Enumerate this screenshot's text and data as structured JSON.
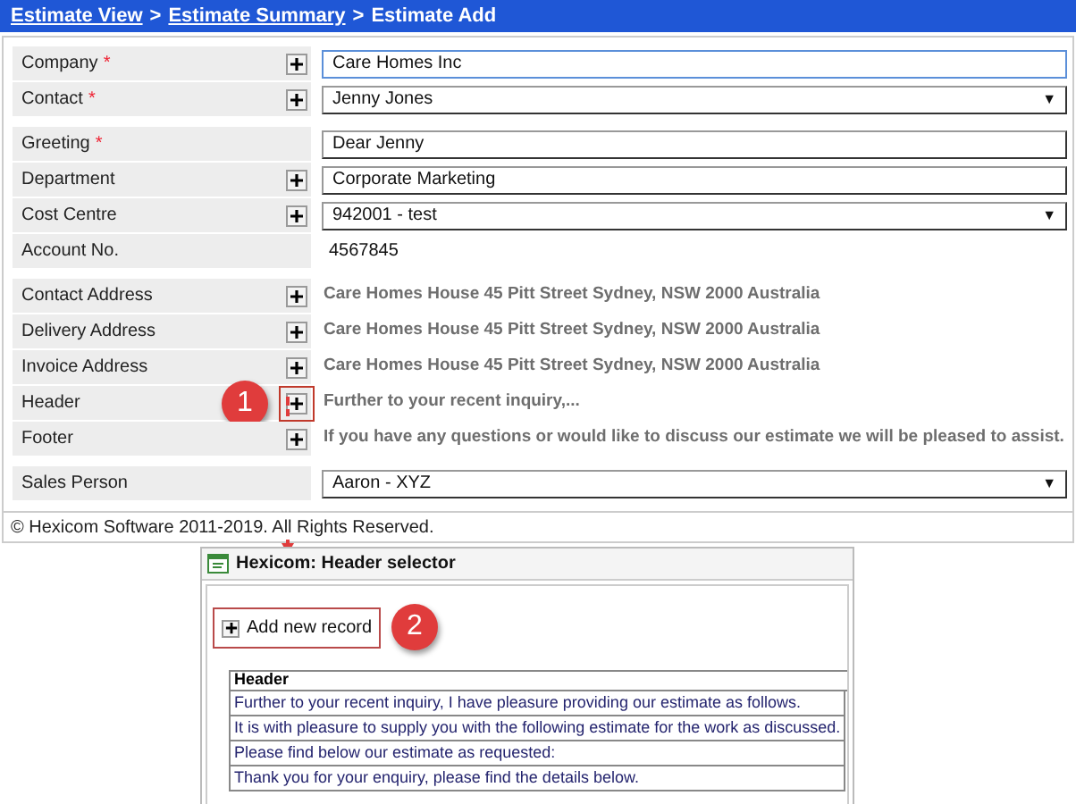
{
  "required_mark": "*",
  "dropdown_arrow": "▼",
  "breadcrumb": {
    "links": [
      "Estimate View",
      "Estimate Summary"
    ],
    "separator": ">",
    "current": "Estimate Add"
  },
  "groups": [
    [
      {
        "label": "Company",
        "required": true,
        "add": true,
        "kind": "input",
        "value": "Care Homes Inc",
        "focused": true
      },
      {
        "label": "Contact",
        "required": true,
        "add": true,
        "kind": "select",
        "value": "Jenny Jones"
      }
    ],
    [
      {
        "label": "Greeting",
        "required": true,
        "add": false,
        "kind": "input",
        "value": "Dear Jenny",
        "focused": false
      },
      {
        "label": "Department",
        "required": false,
        "add": true,
        "kind": "input",
        "value": "Corporate Marketing",
        "focused": false
      },
      {
        "label": "Cost Centre",
        "required": false,
        "add": true,
        "kind": "select",
        "value": "942001 - test"
      },
      {
        "label": "Account No.",
        "required": false,
        "add": false,
        "kind": "text",
        "value": "4567845"
      }
    ],
    [
      {
        "label": "Contact Address",
        "required": false,
        "add": true,
        "kind": "note",
        "value": "Care Homes House 45 Pitt Street Sydney, NSW 2000 Australia"
      },
      {
        "label": "Delivery Address",
        "required": false,
        "add": true,
        "kind": "note",
        "value": "Care Homes House 45 Pitt Street Sydney, NSW 2000 Australia"
      },
      {
        "label": "Invoice Address",
        "required": false,
        "add": true,
        "kind": "note",
        "value": "Care Homes House 45 Pitt Street Sydney, NSW 2000 Australia"
      },
      {
        "label": "Header",
        "required": false,
        "add": true,
        "kind": "note",
        "value": "Further to your recent inquiry,...",
        "callout": "1"
      },
      {
        "label": "Footer",
        "required": false,
        "add": true,
        "kind": "note",
        "value": "If you have any questions or would like to discuss our estimate we will be pleased to assist."
      }
    ],
    [
      {
        "label": "Sales Person",
        "required": false,
        "add": false,
        "kind": "select",
        "value": "Aaron - XYZ"
      }
    ]
  ],
  "copyright": "© Hexicom Software 2011-2019. All Rights Reserved.",
  "popup": {
    "title": "Hexicom: Header selector",
    "add_button": "Add new record",
    "callout": "2",
    "table": {
      "column": "Header",
      "rows": [
        "Further to your recent inquiry, I have pleasure providing our estimate as follows.",
        "It is with pleasure to supply you with the following estimate for the work as discussed.",
        "Please find below our estimate as requested:",
        "Thank you for your enquiry, please find the details below."
      ]
    }
  }
}
